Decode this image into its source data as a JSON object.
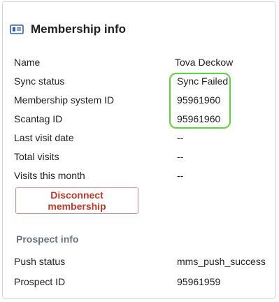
{
  "header": {
    "title": "Membership info",
    "icon": "membership-card-icon"
  },
  "membership": {
    "rows": [
      {
        "label": "Name",
        "value": "Tova Deckow"
      },
      {
        "label": "Sync status",
        "value": "Sync Failed"
      },
      {
        "label": "Membership system ID",
        "value": "95961960"
      },
      {
        "label": "Scantag ID",
        "value": "95961960"
      },
      {
        "label": "Last visit date",
        "value": "--"
      },
      {
        "label": "Total visits",
        "value": "--"
      },
      {
        "label": "Visits this month",
        "value": "--"
      }
    ],
    "disconnect_label": "Disconnect membership"
  },
  "prospect": {
    "title": "Prospect info",
    "rows": [
      {
        "label": "Push status",
        "value": "mms_push_success"
      },
      {
        "label": "Prospect ID",
        "value": "95961959"
      }
    ]
  },
  "colors": {
    "highlight": "#5fd13b",
    "danger": "#c0392b",
    "icon": "#2f5fb3"
  }
}
